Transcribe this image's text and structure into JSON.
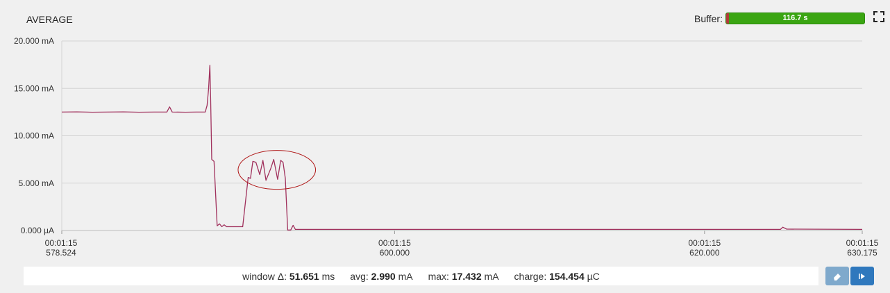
{
  "header": {
    "title": "AVERAGE",
    "buffer_label": "Buffer:",
    "buffer_value": "116.7 s",
    "buffer_fill_fraction": 0.98
  },
  "chart_data": {
    "type": "line",
    "ylabel": "",
    "y_ticks": [
      "20.000 mA",
      "15.000 mA",
      "10.000 mA",
      "5.000 mA",
      "0.000 µA"
    ],
    "y_tick_values": [
      20,
      15,
      10,
      5,
      0
    ],
    "ylim": [
      0,
      20
    ],
    "x_ticks": [
      {
        "time": "00:01:15",
        "ms": "578.524",
        "value": 578.524
      },
      {
        "time": "00:01:15",
        "ms": "600.000",
        "value": 600.0
      },
      {
        "time": "00:01:15",
        "ms": "620.000",
        "value": 620.0
      },
      {
        "time": "00:01:15",
        "ms": "630.175",
        "value": 630.175
      }
    ],
    "xlim": [
      578.524,
      630.175
    ],
    "grid": true,
    "annotation": "ellipse around active burst",
    "annotation_range": [
      589.9,
      594.9
    ],
    "annotation_center_y": 6.4,
    "series": [
      {
        "color": "#a0305c",
        "points": [
          [
            578.524,
            12.5
          ],
          [
            579.5,
            12.52
          ],
          [
            580.5,
            12.48
          ],
          [
            581.5,
            12.5
          ],
          [
            582.5,
            12.52
          ],
          [
            583.5,
            12.48
          ],
          [
            584.5,
            12.5
          ],
          [
            585.3,
            12.5
          ],
          [
            585.48,
            13.05
          ],
          [
            585.65,
            12.5
          ],
          [
            586.5,
            12.48
          ],
          [
            587.2,
            12.5
          ],
          [
            587.78,
            12.5
          ],
          [
            587.9,
            13.2
          ],
          [
            588.0,
            15.0
          ],
          [
            588.08,
            17.43
          ],
          [
            588.13,
            14.0
          ],
          [
            588.2,
            7.5
          ],
          [
            588.35,
            7.3
          ],
          [
            588.55,
            0.5
          ],
          [
            588.7,
            0.7
          ],
          [
            588.85,
            0.4
          ],
          [
            589.0,
            0.6
          ],
          [
            589.15,
            0.4
          ],
          [
            590.2,
            0.4
          ],
          [
            590.55,
            5.6
          ],
          [
            590.7,
            5.5
          ],
          [
            590.85,
            7.3
          ],
          [
            591.05,
            7.2
          ],
          [
            591.3,
            5.9
          ],
          [
            591.5,
            7.4
          ],
          [
            591.7,
            5.3
          ],
          [
            592.0,
            6.5
          ],
          [
            592.2,
            7.5
          ],
          [
            592.45,
            5.4
          ],
          [
            592.65,
            7.4
          ],
          [
            592.8,
            7.2
          ],
          [
            592.95,
            5.5
          ],
          [
            593.1,
            0.05
          ],
          [
            593.3,
            0.05
          ],
          [
            593.45,
            0.55
          ],
          [
            593.6,
            0.12
          ],
          [
            600.0,
            0.12
          ],
          [
            610.0,
            0.12
          ],
          [
            620.0,
            0.12
          ],
          [
            624.9,
            0.12
          ],
          [
            625.05,
            0.35
          ],
          [
            625.3,
            0.15
          ],
          [
            630.175,
            0.12
          ]
        ]
      }
    ]
  },
  "footer": {
    "window_label": "window Δ:",
    "window_value": "51.651",
    "window_unit": "ms",
    "avg_label": "avg:",
    "avg_value": "2.990",
    "avg_unit": "mA",
    "max_label": "max:",
    "max_value": "17.432",
    "max_unit": "mA",
    "charge_label": "charge:",
    "charge_value": "154.454",
    "charge_unit": "µC"
  },
  "icons": {
    "fullscreen": "fullscreen-icon",
    "erase": "eraser-icon",
    "play": "play-icon"
  },
  "colors": {
    "trace": "#a0305c",
    "annotation": "#b01818",
    "buffer": "#3aa512",
    "button_primary": "#2f78bd",
    "button_secondary": "#7fa9cc"
  }
}
